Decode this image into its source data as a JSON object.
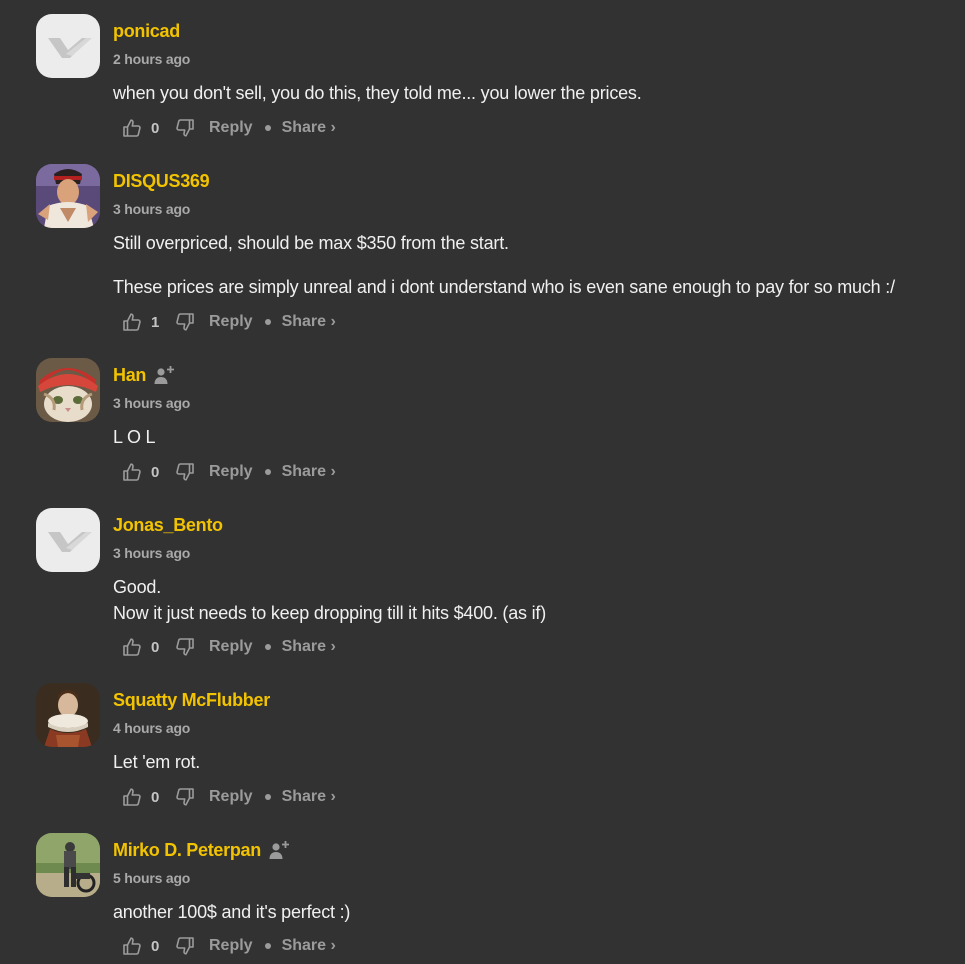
{
  "colors": {
    "background": "#323232",
    "author": "#f2c300",
    "meta": "#a9a9a9",
    "action": "#9b9b9b"
  },
  "action_labels": {
    "reply": "Reply",
    "share": "Share ›"
  },
  "icons": {
    "upvote": "thumbs-up-icon",
    "downvote": "thumbs-down-icon",
    "follow": "follow-user-icon",
    "separator": "dot-separator"
  },
  "comments": [
    {
      "author": "ponicad",
      "time": "2 hours ago",
      "body": [
        "when you don't sell, you do this, they told me... you lower the prices."
      ],
      "upvotes": "0",
      "avatar": "default-logo-avatar",
      "follow": false
    },
    {
      "author": "DISQUS369",
      "time": "3 hours ago",
      "body": [
        "Still overpriced, should be max $350 from the start.",
        "These prices are simply unreal and i dont understand who is even sane enough to pay for so much :/"
      ],
      "upvotes": "1",
      "avatar": "fighter-avatar",
      "follow": false
    },
    {
      "author": "Han",
      "time": "3 hours ago",
      "body": [
        "L O L"
      ],
      "upvotes": "0",
      "avatar": "cat-with-bandana-avatar",
      "follow": true
    },
    {
      "author": "Jonas_Bento",
      "time": "3 hours ago",
      "body": [
        "Good.\nNow it just needs to keep dropping till it hits $400. (as if)"
      ],
      "upvotes": "0",
      "avatar": "default-logo-avatar",
      "follow": false
    },
    {
      "author": "Squatty McFlubber",
      "time": "4 hours ago",
      "body": [
        "Let 'em rot."
      ],
      "upvotes": "0",
      "avatar": "portrait-painting-avatar",
      "follow": false
    },
    {
      "author": "Mirko D. Peterpan",
      "time": "5 hours ago",
      "body": [
        "another 100$ and it's perfect :)"
      ],
      "upvotes": "0",
      "avatar": "motorbike-photo-avatar",
      "follow": true
    }
  ]
}
